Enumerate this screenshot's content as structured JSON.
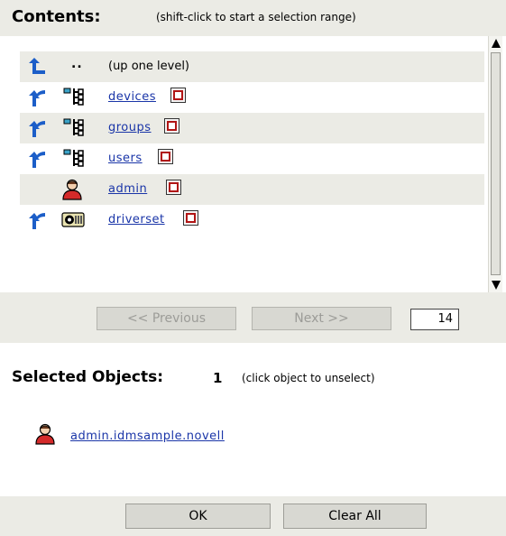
{
  "contents": {
    "title": "Contents:",
    "hint": "(shift-click to start a selection range)"
  },
  "list": {
    "up_dots": "..",
    "up_label": "(up one level)",
    "items": [
      {
        "name": "devices",
        "icon": "container-icon",
        "expandable": true
      },
      {
        "name": "groups",
        "icon": "container-icon",
        "expandable": true
      },
      {
        "name": "users",
        "icon": "container-icon",
        "expandable": true
      },
      {
        "name": "admin",
        "icon": "user-icon",
        "expandable": false
      },
      {
        "name": "driverset",
        "icon": "driverset-icon",
        "expandable": true
      }
    ]
  },
  "pager": {
    "previous_label": "<< Previous",
    "next_label": "Next >>",
    "page_value": "14"
  },
  "selected": {
    "title": "Selected Objects:",
    "count": "1",
    "hint": "(click object to unselect)",
    "items": [
      {
        "name": "admin.idmsample.novell",
        "icon": "user-icon"
      }
    ]
  },
  "buttons": {
    "ok_label": "OK",
    "clear_all_label": "Clear All"
  },
  "colors": {
    "band": "#ebebe5",
    "link": "#1a35a8",
    "select_box": "#b11515",
    "arrow": "#1c5ec8"
  }
}
